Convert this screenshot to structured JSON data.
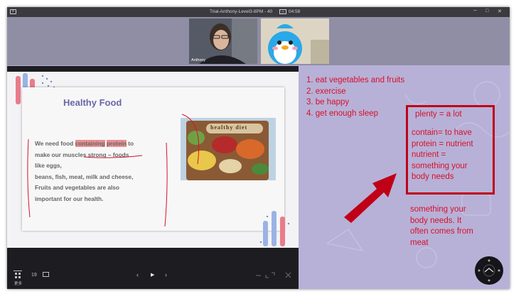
{
  "titlebar": {
    "title": "Trial-Anthony-Level3-8PM - 40",
    "time": "04:58",
    "app_icon": "window-icon",
    "minimize": "─",
    "maximize": "□",
    "close": "✕"
  },
  "video": {
    "teacher_name": "Anthony"
  },
  "slide": {
    "title": "Healthy Food",
    "line1_prefix": "We need food ",
    "line1_hl1": "containing",
    "line1_hl2": "protein",
    "line1_suffix": " to",
    "line2": "make our muscles strong – foods",
    "line3": "like eggs,",
    "line4": "beans, fish, meat, milk and cheese,",
    "line5": "Fruits and vegetables are also",
    "line6": "important for our health.",
    "photo_label": "healthy diet"
  },
  "toolbar": {
    "grid_label": "更多",
    "page_number": "19",
    "prev": "‹",
    "play": "▶",
    "next": "›"
  },
  "notes": {
    "list": [
      "1. eat vegetables and fruits",
      "2. exercise",
      "3. be happy",
      "4. get enough sleep"
    ],
    "box_title": "plenty = a lot",
    "box_lines": [
      "contain= to have",
      "protein = nutrient",
      "nutrient =",
      "something your",
      "body needs"
    ],
    "extra_lines": [
      "something your",
      "body needs. It",
      "often comes from",
      "meat"
    ]
  },
  "colors": {
    "ink": "#d8102a",
    "board": "#b7b1d8",
    "slide_title": "#6a67a6",
    "highlight": "#e88f92"
  }
}
